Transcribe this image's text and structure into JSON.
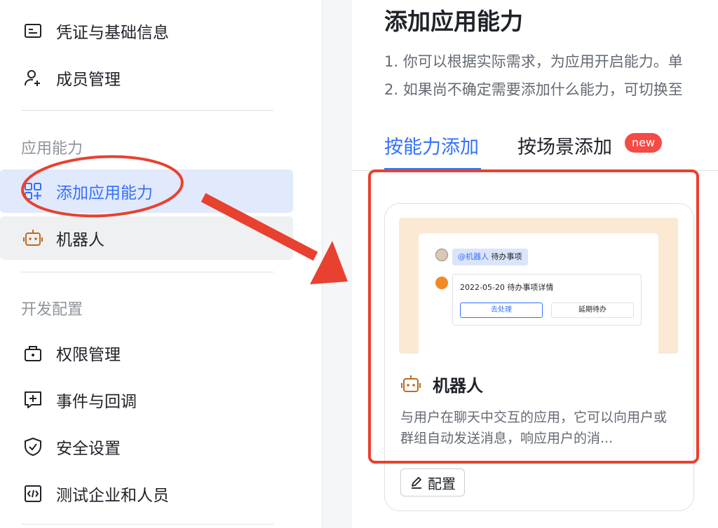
{
  "sidebar": {
    "items_top": [
      {
        "label": "凭证与基础信息",
        "icon": "id-card-icon"
      },
      {
        "label": "成员管理",
        "icon": "add-member-icon"
      }
    ],
    "groups": [
      {
        "label": "应用能力"
      },
      {
        "label": "开发配置"
      }
    ],
    "capability_items": [
      {
        "label": "添加应用能力",
        "icon": "add-apps-icon"
      },
      {
        "label": "机器人",
        "icon": "robot-icon"
      }
    ],
    "dev_items": [
      {
        "label": "权限管理",
        "icon": "lock-briefcase-icon"
      },
      {
        "label": "事件与回调",
        "icon": "event-plus-icon"
      },
      {
        "label": "安全设置",
        "icon": "shield-icon"
      },
      {
        "label": "测试企业和人员",
        "icon": "code-box-icon"
      }
    ]
  },
  "main": {
    "title": "添加应用能力",
    "desc_lines": [
      "1. 你可以根据实际需求，为应用开启能力。单",
      "2. 如果尚不确定需要添加什么能力，可切换至"
    ],
    "tabs": [
      {
        "label": "按能力添加",
        "active": true
      },
      {
        "label": "按场景添加",
        "active": false
      }
    ],
    "new_badge": "new",
    "card": {
      "preview": {
        "mention": "@机器人",
        "mention_text": "待办事项",
        "msg_title": "2022-05-20 待办事项详情",
        "btn_primary": "去处理",
        "btn_default": "延期待办"
      },
      "title": "机器人",
      "desc": "与用户在聊天中交互的应用，它可以向用户或群组自动发送消息，响应用户的消...",
      "config_label": "配置"
    }
  },
  "colors": {
    "accent": "#3370ff",
    "active_bg": "#e1e9fd",
    "annotation_red": "#e8412f",
    "badge_red": "#f54a45",
    "robot_orange": "#c26a1b"
  }
}
